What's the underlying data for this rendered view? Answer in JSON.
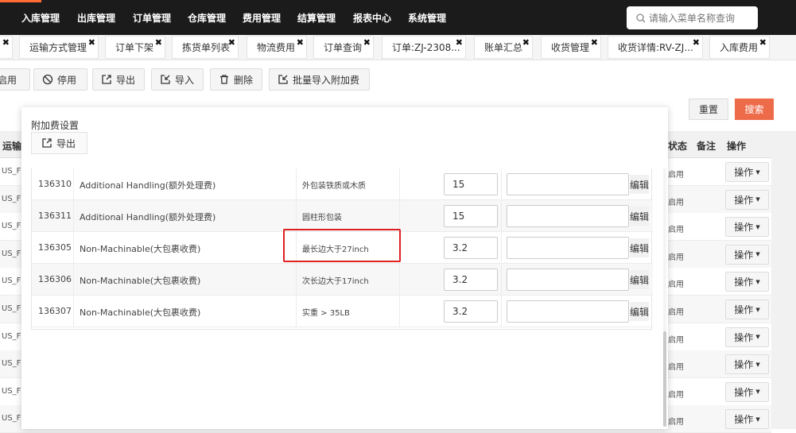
{
  "topnav": {
    "items": [
      "入库管理",
      "出库管理",
      "订单管理",
      "仓库管理",
      "费用管理",
      "结算管理",
      "报表中心",
      "系统管理"
    ],
    "search_placeholder": "请输入菜单名称查询"
  },
  "tabs": [
    "运输方式管理",
    "订单下架",
    "拣货单列表",
    "物流费用",
    "订单查询",
    "订单:ZJ-2308...",
    "账单汇总",
    "收货管理",
    "收货详情:RV-ZJ...",
    "入库费用"
  ],
  "toolbar": {
    "enable": "启用",
    "disable": "停用",
    "export": "导出",
    "import": "导入",
    "delete": "删除",
    "batch_import": "批量导入附加费"
  },
  "filter": {
    "btn_reset": "重置",
    "btn_search": "搜索"
  },
  "bg_table": {
    "col_partial": "运输",
    "col_status": "状态",
    "col_remark": "备注",
    "col_action": "操作",
    "row_left": "US_F",
    "row_status": "启用",
    "row_action": "操作"
  },
  "modal": {
    "title": "附加费设置",
    "export_label": "导出",
    "edit_label": "编辑",
    "close_symbol": "×",
    "rows": [
      {
        "id": "136310",
        "name": "Additional Handling(额外处理费)",
        "desc": "外包装铁质或木质",
        "value": "15"
      },
      {
        "id": "136311",
        "name": "Additional Handling(额外处理费)",
        "desc": "圆柱形包装",
        "value": "15"
      },
      {
        "id": "136305",
        "name": "Non-Machinable(大包裹收费)",
        "desc": "最长边大于27inch",
        "value": "3.2"
      },
      {
        "id": "136306",
        "name": "Non-Machinable(大包裹收费)",
        "desc": "次长边大于17inch",
        "value": "3.2"
      },
      {
        "id": "136307",
        "name": "Non-Machinable(大包裹收费)",
        "desc": "实重 > 35LB",
        "value": "3.2"
      }
    ]
  }
}
